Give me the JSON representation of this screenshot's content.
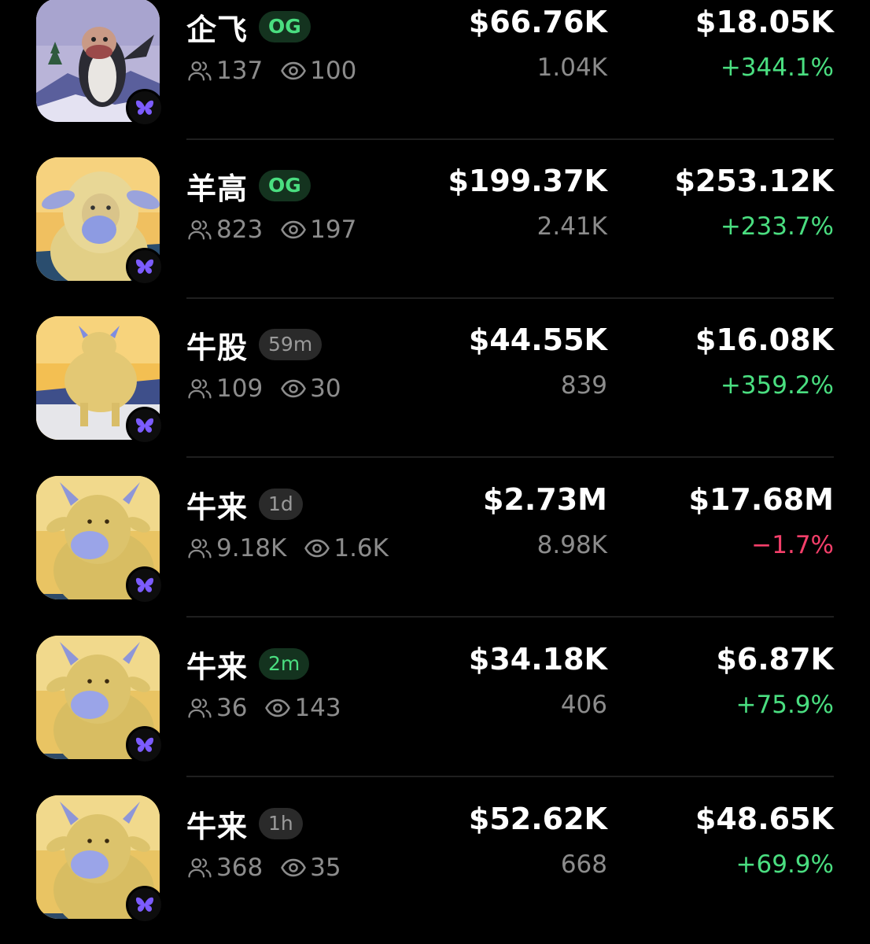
{
  "rows": [
    {
      "avatar": "penguin-avatar",
      "name": "企飞",
      "tag": "OG",
      "tag_style": "og",
      "holders": "137",
      "watchers": "100",
      "market_cap": "$66.76K",
      "market_cap_sub": "1.04K",
      "volume": "$18.05K",
      "change": "+344.1%",
      "change_dir": "up"
    },
    {
      "avatar": "sheep-avatar",
      "name": "羊高",
      "tag": "OG",
      "tag_style": "og",
      "holders": "823",
      "watchers": "197",
      "market_cap": "$199.37K",
      "market_cap_sub": "2.41K",
      "volume": "$253.12K",
      "change": "+233.7%",
      "change_dir": "up"
    },
    {
      "avatar": "bull-back-avatar",
      "name": "牛股",
      "tag": "59m",
      "tag_style": "time",
      "holders": "109",
      "watchers": "30",
      "market_cap": "$44.55K",
      "market_cap_sub": "839",
      "volume": "$16.08K",
      "change": "+359.2%",
      "change_dir": "up"
    },
    {
      "avatar": "bull-avatar",
      "name": "牛来",
      "tag": "1d",
      "tag_style": "time",
      "holders": "9.18K",
      "watchers": "1.6K",
      "market_cap": "$2.73M",
      "market_cap_sub": "8.98K",
      "volume": "$17.68M",
      "change": "−1.7%",
      "change_dir": "down"
    },
    {
      "avatar": "bull-avatar",
      "name": "牛来",
      "tag": "2m",
      "tag_style": "new",
      "holders": "36",
      "watchers": "143",
      "market_cap": "$34.18K",
      "market_cap_sub": "406",
      "volume": "$6.87K",
      "change": "+75.9%",
      "change_dir": "up"
    },
    {
      "avatar": "bull-avatar",
      "name": "牛来",
      "tag": "1h",
      "tag_style": "time",
      "holders": "368",
      "watchers": "35",
      "market_cap": "$52.62K",
      "market_cap_sub": "668",
      "volume": "$48.65K",
      "change": "+69.9%",
      "change_dir": "up"
    }
  ],
  "colors": {
    "up": "#4ade80",
    "down": "#f43f6a",
    "badge_accent": "#7c5cff"
  }
}
